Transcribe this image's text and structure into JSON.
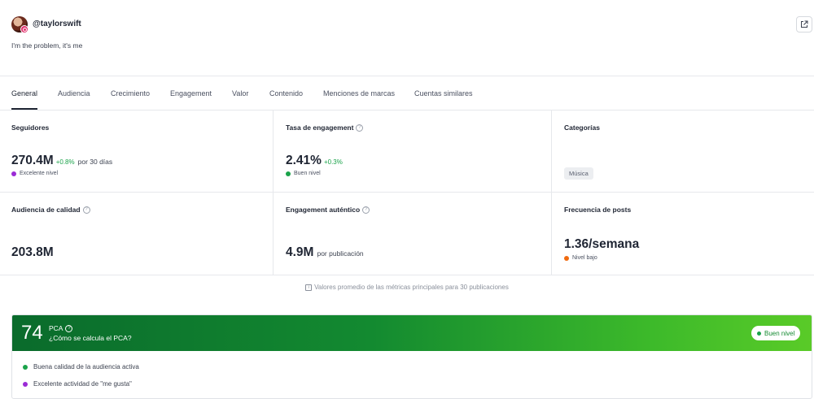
{
  "profile": {
    "username": "@taylorswift",
    "bio": "I'm the problem, it's me",
    "platform_icon": "instagram-icon",
    "external_link_icon": "external-link-icon"
  },
  "tabs": [
    {
      "label": "General",
      "active": true
    },
    {
      "label": "Audiencia"
    },
    {
      "label": "Crecimiento"
    },
    {
      "label": "Engagement"
    },
    {
      "label": "Valor"
    },
    {
      "label": "Contenido"
    },
    {
      "label": "Menciones de marcas"
    },
    {
      "label": "Cuentas similares"
    }
  ],
  "metrics": {
    "followers": {
      "label": "Seguidores",
      "value": "270.4M",
      "delta": "+0.8%",
      "period": "por 30 días",
      "level": "Excelente nivel",
      "level_color": "#9b2bd6"
    },
    "engagement_rate": {
      "label": "Tasa de engagement",
      "value": "2.41%",
      "delta": "+0.3%",
      "level": "Buen nivel",
      "level_color": "#1aa34a"
    },
    "categories": {
      "label": "Categorías",
      "tags": [
        "Música"
      ]
    },
    "quality_audience": {
      "label": "Audiencia de calidad",
      "value": "203.8M"
    },
    "authentic_engagement": {
      "label": "Engagement auténtico",
      "value": "4.9M",
      "unit": "por publicación"
    },
    "post_frequency": {
      "label": "Frecuencia de posts",
      "value": "1.36/semana",
      "level": "Nivel bajo",
      "level_color": "#f06a0f"
    }
  },
  "footnote": "Valores promedio de las métricas principales para 30 publicaciones",
  "pca": {
    "score": "74",
    "title": "PCA",
    "link": "¿Cómo se calcula el PCA?",
    "badge": "Buen nivel",
    "items": [
      {
        "text": "Buena calidad de la audiencia activa",
        "color": "#1aa34a"
      },
      {
        "text": "Excelente actividad de \"me gusta\"",
        "color": "#9b2bd6"
      }
    ]
  }
}
